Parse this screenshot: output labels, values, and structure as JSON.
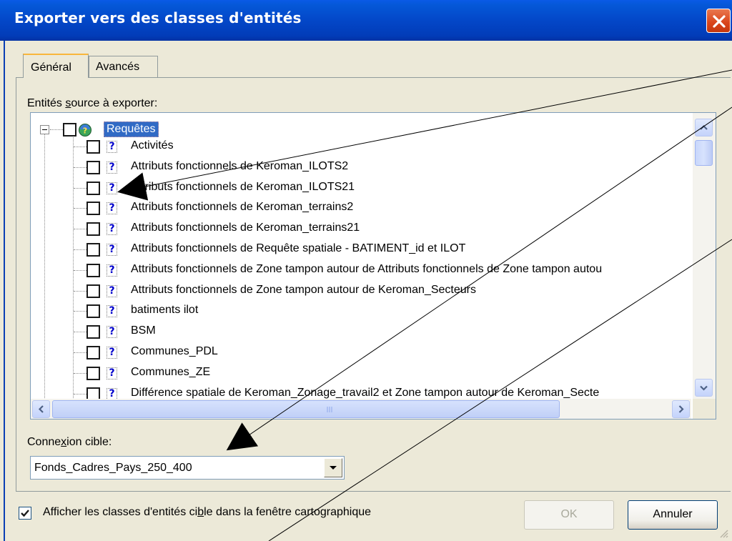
{
  "dialog": {
    "title": "Exporter vers des classes d'entités",
    "close_icon": "close-icon"
  },
  "tabs": [
    {
      "label": "Général",
      "active": true
    },
    {
      "label": "Avancés",
      "active": false
    }
  ],
  "source_section": {
    "label_pre": "Entités ",
    "label_accel": "s",
    "label_post": "ource à exporter:"
  },
  "tree": {
    "root": {
      "label": "Requêtes",
      "icon": "database-query-icon",
      "checked": false,
      "expanded": true
    },
    "items": [
      {
        "label": "Activités",
        "checked": false
      },
      {
        "label": "Attributs fonctionnels de Keroman_ILOTS2",
        "checked": false
      },
      {
        "label": "Attributs fonctionnels de Keroman_ILOTS21",
        "checked": false
      },
      {
        "label": "Attributs fonctionnels de Keroman_terrains2",
        "checked": false
      },
      {
        "label": "Attributs fonctionnels de Keroman_terrains21",
        "checked": false
      },
      {
        "label": "Attributs fonctionnels de Requête spatiale - BATIMENT_id et ILOT",
        "checked": false
      },
      {
        "label": "Attributs fonctionnels de Zone tampon autour de Attributs fonctionnels de Zone tampon autou",
        "checked": false
      },
      {
        "label": "Attributs fonctionnels de Zone tampon autour de Keroman_Secteurs",
        "checked": false
      },
      {
        "label": "batiments ilot",
        "checked": false
      },
      {
        "label": "BSM",
        "checked": false
      },
      {
        "label": "Communes_PDL",
        "checked": false
      },
      {
        "label": "Communes_ZE",
        "checked": false
      },
      {
        "label": "Différence spatiale de  Keroman_Zonage_travail2 et Zone tampon autour de Keroman_Secte",
        "checked": false
      }
    ],
    "item_icon": "question-mark-icon"
  },
  "connection": {
    "label_pre": "Conne",
    "label_accel": "x",
    "label_post": "ion cible:",
    "value": "Fonds_Cadres_Pays_250_400"
  },
  "show_in_map": {
    "checked": true,
    "label_pre": "Afficher les classes d'entités ci",
    "label_accel": "b",
    "label_post": "le dans la fenêtre cartographique"
  },
  "buttons": {
    "ok": "OK",
    "cancel": "Annuler"
  },
  "colors": {
    "titlebar": "#0347c8",
    "selection": "#316ac5",
    "dialog_bg": "#ece9d8",
    "close_button": "#d9441a"
  }
}
